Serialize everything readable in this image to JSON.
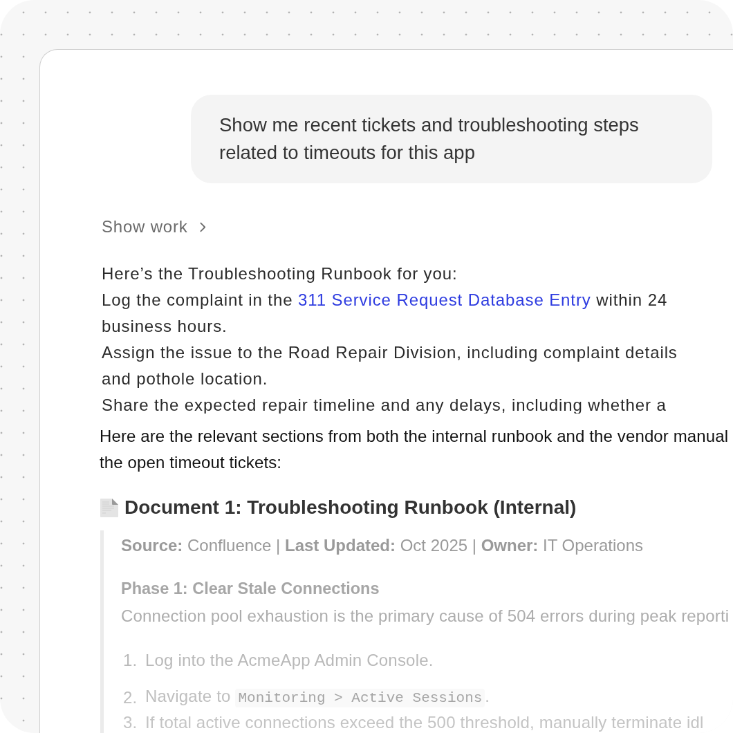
{
  "user_message": {
    "text": "Show me recent tickets and troubleshooting steps related to timeouts for this app"
  },
  "show_work": {
    "label": "Show work",
    "expanded": false
  },
  "runbook_preview": {
    "paragraphs": [
      [
        {
          "kind": "text",
          "text": "Here’s the Troubleshooting Runbook for you:"
        }
      ],
      [
        {
          "kind": "text",
          "text": "Log the complaint in the "
        },
        {
          "kind": "link",
          "text": "311 Service Request Database Entry"
        },
        {
          "kind": "text",
          "text": " within 24 business hours."
        }
      ],
      [
        {
          "kind": "text",
          "text": "Assign the issue to the Road Repair Division, including complaint details and pothole location."
        }
      ],
      [
        {
          "kind": "text",
          "text": "Share the expected repair timeline and any delays, including whether a"
        }
      ]
    ]
  },
  "intro_lines": [
    "Here are the relevant sections from both the internal runbook and the vendor manual",
    "the open timeout tickets:"
  ],
  "document": {
    "title": "Document 1: Troubleshooting Runbook (Internal)",
    "source": "**Source:** Confluence | **Last Updated:** Oct 2025 | **Owner:** IT Operations",
    "phase": {
      "title": "Phase 1: Clear Stale Connections",
      "text": "Connection pool exhaustion is the primary cause of 504 errors during peak reporti"
    },
    "steps": [
      {
        "number": "1.",
        "parts": [
          {
            "kind": "text",
            "text": "Log into the AcmeApp Admin Console."
          }
        ]
      },
      {
        "number": "2.",
        "parts": [
          {
            "kind": "text",
            "text": "Navigate to "
          },
          {
            "kind": "code",
            "text": "Monitoring > Active Sessions"
          },
          {
            "kind": "text",
            "text": "."
          }
        ]
      },
      {
        "number": "3.",
        "parts": [
          {
            "kind": "text",
            "text": "If total active connections exceed the 500 threshold, manually terminate idl"
          }
        ]
      }
    ]
  }
}
